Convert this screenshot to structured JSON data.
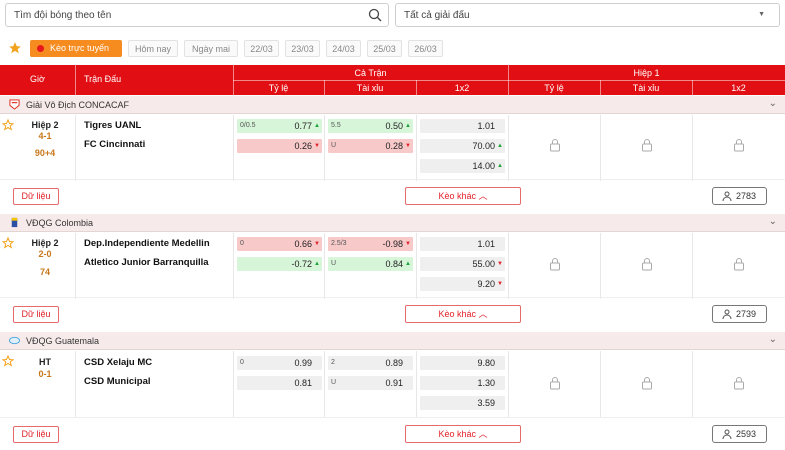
{
  "search": {
    "placeholder": "Tìm đội bóng theo tên"
  },
  "league_filter": {
    "value": "Tất cả giải đấu"
  },
  "datebar": {
    "live_label": "Kèo trực tuyến",
    "dates": [
      "Hôm nay",
      "Ngày mai",
      "22/03",
      "23/03",
      "24/03",
      "25/03",
      "26/03"
    ]
  },
  "header": {
    "time": "Giờ",
    "match": "Trận Đấu",
    "full": "Cả Trận",
    "half": "Hiệp 1",
    "handicap": "Tỷ lệ",
    "overunder": "Tài xỉu",
    "x12": "1x2"
  },
  "labels": {
    "data_button": "Dữ liệu",
    "more_odds": "Kèo khác"
  },
  "colors": {
    "accent": "#e10f13",
    "live": "#f68b1f",
    "score": "#c7771b",
    "up": "#1ea23a",
    "down": "#e2222a"
  },
  "leagues": [
    {
      "name": "Giải Vô Địch CONCACAF",
      "match": {
        "status": "Hiệp 2",
        "score": "4-1",
        "minute": "90+4",
        "home": "Tigres UANL",
        "away": "FC Cincinnati",
        "hdp": [
          {
            "label": "0/0.5",
            "value": "0.77",
            "trend": "up"
          },
          {
            "label": "",
            "value": "0.26",
            "trend": "down"
          }
        ],
        "ou": [
          {
            "label": "5.5",
            "value": "0.50",
            "trend": "up"
          },
          {
            "label": "U",
            "value": "0.28",
            "trend": "down"
          }
        ],
        "x12": [
          {
            "value": "1.01",
            "trend": ""
          },
          {
            "value": "70.00",
            "trend": "up"
          },
          {
            "value": "14.00",
            "trend": "up"
          }
        ],
        "fans": "2783"
      }
    },
    {
      "name": "VĐQG Colombia",
      "match": {
        "status": "Hiệp 2",
        "score": "2-0",
        "minute": "74",
        "home": "Dep.Independiente Medellin",
        "away": "Atletico Junior Barranquilla",
        "hdp": [
          {
            "label": "0",
            "value": "0.66",
            "trend": "down"
          },
          {
            "label": "",
            "value": "-0.72",
            "trend": "up"
          }
        ],
        "ou": [
          {
            "label": "2.5/3",
            "value": "-0.98",
            "trend": "down"
          },
          {
            "label": "U",
            "value": "0.84",
            "trend": "up"
          }
        ],
        "x12": [
          {
            "value": "1.01",
            "trend": ""
          },
          {
            "value": "55.00",
            "trend": "down"
          },
          {
            "value": "9.20",
            "trend": "down"
          }
        ],
        "fans": "2739"
      }
    },
    {
      "name": "VĐQG Guatemala",
      "match": {
        "status": "HT",
        "score": "0-1",
        "minute": "",
        "home": "CSD Xelaju MC",
        "away": "CSD Municipal",
        "hdp": [
          {
            "label": "0",
            "value": "0.99",
            "trend": ""
          },
          {
            "label": "",
            "value": "0.81",
            "trend": ""
          }
        ],
        "ou": [
          {
            "label": "2",
            "value": "0.89",
            "trend": ""
          },
          {
            "label": "U",
            "value": "0.91",
            "trend": ""
          }
        ],
        "x12": [
          {
            "value": "9.80",
            "trend": ""
          },
          {
            "value": "1.30",
            "trend": ""
          },
          {
            "value": "3.59",
            "trend": ""
          }
        ],
        "fans": "2593"
      }
    }
  ]
}
